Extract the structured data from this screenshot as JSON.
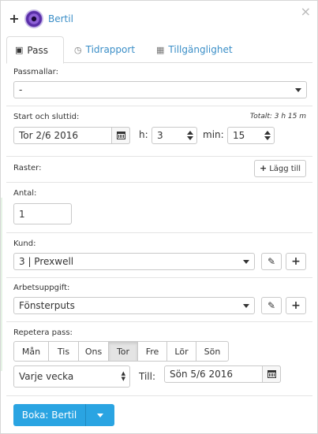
{
  "header": {
    "user_name": "Bertil"
  },
  "tabs": [
    {
      "label": "Pass",
      "icon": "id-card-icon"
    },
    {
      "label": "Tidrapport",
      "icon": "clock-icon"
    },
    {
      "label": "Tillgänglighet",
      "icon": "calendar-icon"
    }
  ],
  "templates": {
    "label": "Passmallar:",
    "value": "-"
  },
  "time": {
    "label": "Start och sluttid:",
    "total": "Totalt: 3 h 15 m",
    "date": "Tor 2/6 2016",
    "hours_label": "h:",
    "hours": "3",
    "minutes_label": "min:",
    "minutes": "15"
  },
  "breaks": {
    "label": "Raster:",
    "add_label": "Lägg till"
  },
  "count": {
    "label": "Antal:",
    "value": "1"
  },
  "customer": {
    "label": "Kund:",
    "value": "3 | Prexwell"
  },
  "task": {
    "label": "Arbetsuppgift:",
    "value": "Fönsterputs"
  },
  "repeat": {
    "label": "Repetera pass:",
    "days": [
      "Mån",
      "Tis",
      "Ons",
      "Tor",
      "Fre",
      "Lör",
      "Sön"
    ],
    "active_day": "Tor",
    "frequency": "Varje vecka",
    "until_label": "Till:",
    "until_date": "Sön 5/6 2016"
  },
  "actions": {
    "book_label": "Boka: Bertil"
  },
  "colors": {
    "accent": "#2aa4e2",
    "link": "#3a8ec7"
  }
}
